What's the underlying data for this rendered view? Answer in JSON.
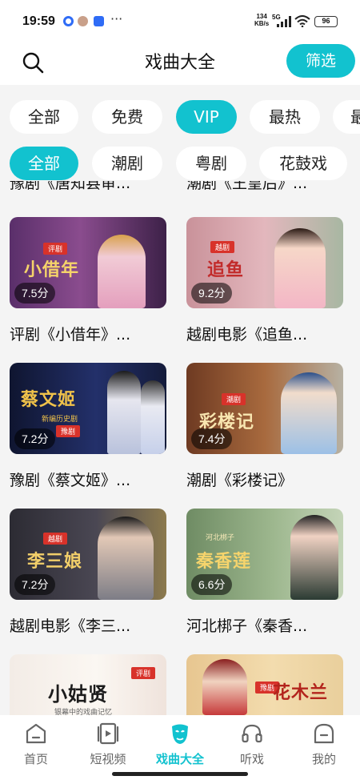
{
  "status_bar": {
    "time": "19:59",
    "speed_value": "134",
    "speed_unit": "KB/s",
    "network": "5G",
    "battery": "96"
  },
  "header": {
    "title": "戏曲大全",
    "filter_label": "筛选",
    "search_icon": "search-icon"
  },
  "category_chips": [
    "全部",
    "免费",
    "VIP",
    "最热",
    "最"
  ],
  "category_active_index": 2,
  "genre_chips": [
    "全部",
    "潮剧",
    "粤剧",
    "花鼓戏"
  ],
  "genre_active_index": 0,
  "partial_row": [
    "豫剧《唐知县审...",
    "潮剧《王皇后》..."
  ],
  "cards": [
    {
      "score": "7.5分",
      "label": "评剧《小借年》...",
      "thumb_title": "小借年",
      "thumb_tag": "评剧"
    },
    {
      "score": "9.2分",
      "label": "越剧电影《追鱼...",
      "thumb_title": "追鱼",
      "thumb_tag": "越剧"
    },
    {
      "score": "7.2分",
      "label": "豫剧《蔡文姬》...",
      "thumb_title": "蔡文姬",
      "thumb_tag": "豫剧",
      "thumb_sub": "新编历史剧"
    },
    {
      "score": "7.4分",
      "label": "潮剧《彩楼记》",
      "thumb_title": "彩楼记",
      "thumb_tag": "潮剧"
    },
    {
      "score": "7.2分",
      "label": "越剧电影《李三...",
      "thumb_title": "李三娘",
      "thumb_tag": "越剧"
    },
    {
      "score": "6.6分",
      "label": "河北梆子《秦香...",
      "thumb_title": "秦香莲",
      "thumb_tag": "河北梆子"
    },
    {
      "score": "",
      "label": "",
      "thumb_title": "小姑贤",
      "thumb_tag": "评剧",
      "thumb_sub": "银幕中的戏曲记忆"
    },
    {
      "score": "",
      "label": "",
      "thumb_title": "花木兰",
      "thumb_tag": "豫剧"
    }
  ],
  "tabs": [
    {
      "label": "首页",
      "icon": "home-icon"
    },
    {
      "label": "短视频",
      "icon": "short-video-icon"
    },
    {
      "label": "戏曲大全",
      "icon": "opera-mask-icon"
    },
    {
      "label": "听戏",
      "icon": "headphones-icon"
    },
    {
      "label": "我的",
      "icon": "profile-icon"
    }
  ],
  "active_tab_index": 2,
  "colors": {
    "accent": "#12c2cf",
    "background": "#f4f4f4",
    "card_bg": "#ffffff"
  }
}
